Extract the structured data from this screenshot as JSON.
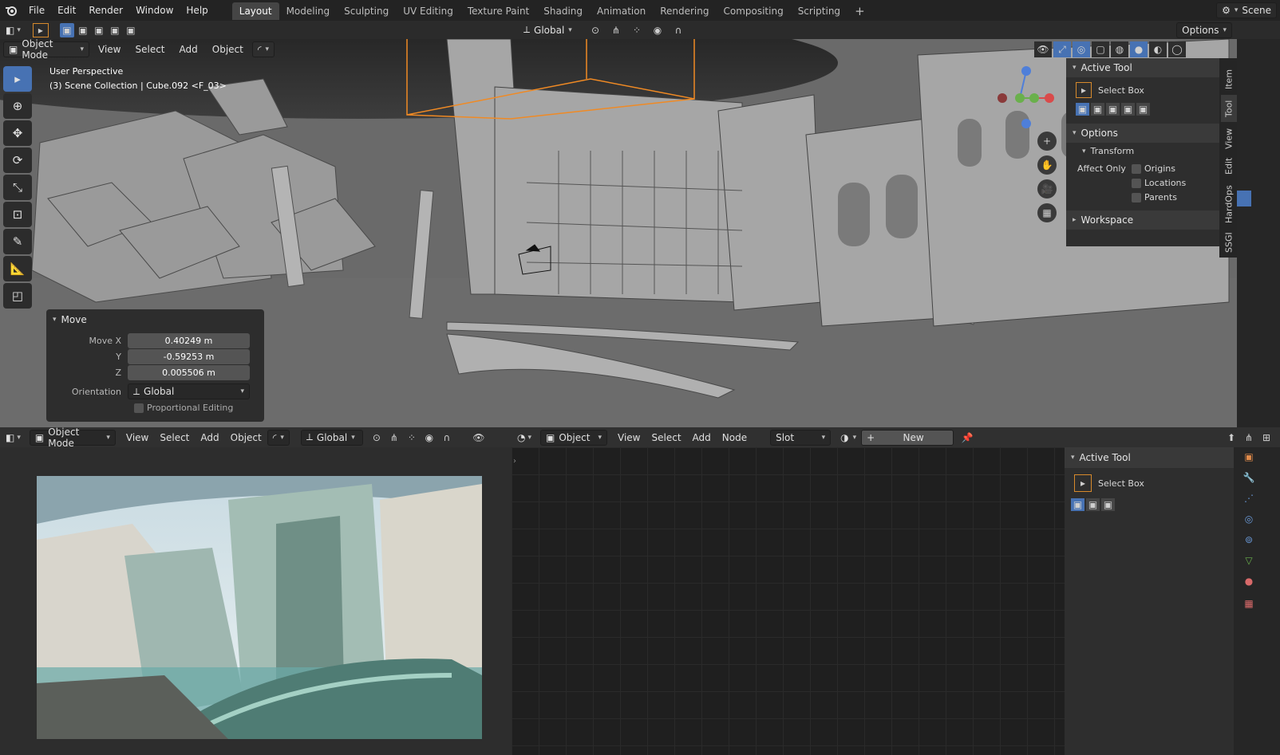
{
  "menubar": {
    "items": [
      "File",
      "Edit",
      "Render",
      "Window",
      "Help"
    ],
    "workspaces": [
      "Layout",
      "Modeling",
      "Sculpting",
      "UV Editing",
      "Texture Paint",
      "Shading",
      "Animation",
      "Rendering",
      "Compositing",
      "Scripting"
    ],
    "active_workspace": "Layout",
    "add_tab": "+",
    "scene": "Scene"
  },
  "header_top": {
    "transform_orientation": "Global",
    "options": "Options"
  },
  "viewport_header": {
    "mode": "Object Mode",
    "menus": [
      "View",
      "Select",
      "Add",
      "Object"
    ]
  },
  "viewport": {
    "perspective": "User Perspective",
    "collection": "(3) Scene Collection | Cube.092 <F_03>"
  },
  "move_panel": {
    "title": "Move",
    "move_x_label": "Move X",
    "move_x": "0.40249 m",
    "y_label": "Y",
    "y": "-0.59253 m",
    "z_label": "Z",
    "z": "0.005506 m",
    "orientation_label": "Orientation",
    "orientation": "Global",
    "proportional": "Proportional Editing"
  },
  "sidebar": {
    "active_tool": "Active Tool",
    "select_box": "Select Box",
    "options": "Options",
    "transform": "Transform",
    "affect_only": "Affect Only",
    "origins": "Origins",
    "locations": "Locations",
    "parents": "Parents",
    "workspace": "Workspace",
    "tabs": [
      "Item",
      "Tool",
      "View",
      "Edit",
      "HardOps",
      "SSGI"
    ]
  },
  "bottom_left_header": {
    "mode": "Object Mode",
    "menus": [
      "View",
      "Select",
      "Add",
      "Object"
    ],
    "orientation": "Global"
  },
  "shader_header": {
    "object": "Object",
    "menus": [
      "View",
      "Select",
      "Add",
      "Node"
    ],
    "slot": "Slot",
    "new": "New"
  },
  "shader_sidebar": {
    "active_tool": "Active Tool",
    "select_box": "Select Box"
  },
  "colors": {
    "accent": "#4772b3",
    "selection": "#f08a24"
  }
}
